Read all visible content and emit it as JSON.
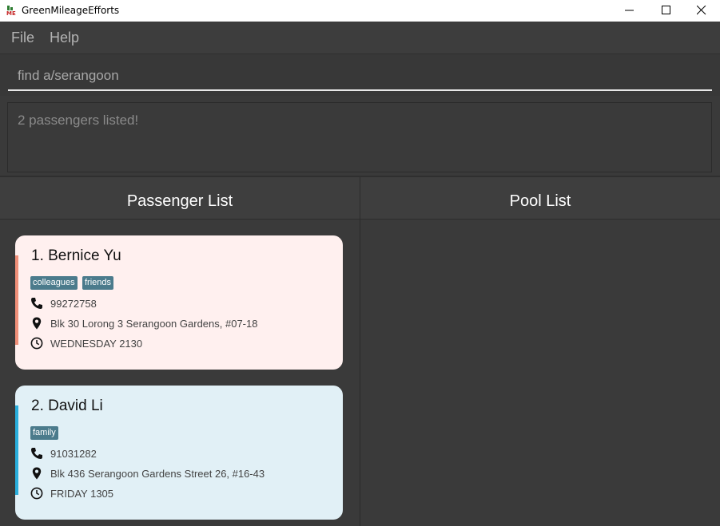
{
  "window": {
    "title": "GreenMileageEfforts"
  },
  "menu": {
    "file": "File",
    "help": "Help"
  },
  "command": {
    "value": "find a/serangoon"
  },
  "result": {
    "message": "2 passengers listed!"
  },
  "panels": {
    "passenger_list": "Passenger List",
    "pool_list": "Pool List"
  },
  "passengers": [
    {
      "name": "1.  Bernice Yu",
      "tags": [
        "colleagues",
        "friends"
      ],
      "phone": "99272758",
      "address": "Blk 30 Lorong 3 Serangoon Gardens, #07-18",
      "time": "WEDNESDAY 2130",
      "background": "#fff0ef",
      "accent": "#f08f78"
    },
    {
      "name": "2.  David Li",
      "tags": [
        "family"
      ],
      "phone": "91031282",
      "address": "Blk 436 Serangoon Gardens Street 26, #16-43",
      "time": "FRIDAY 1305",
      "background": "#e1f0f6",
      "accent": "#29aedc"
    }
  ],
  "icons": {
    "phone": "phone-icon",
    "address": "location-pin-icon",
    "time": "clock-icon"
  }
}
